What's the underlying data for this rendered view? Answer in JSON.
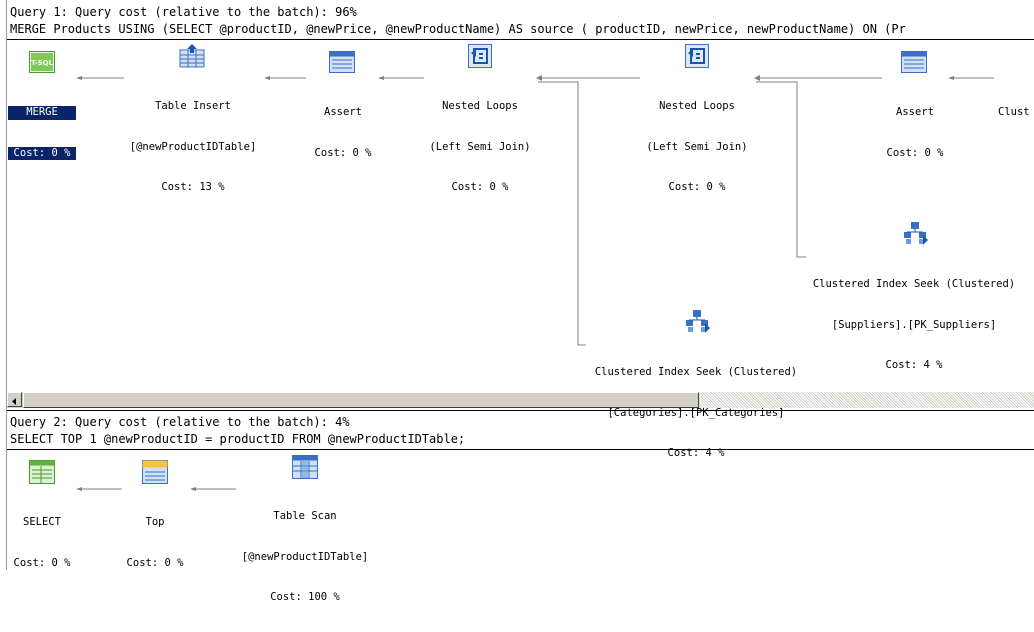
{
  "query1": {
    "header": "Query 1: Query cost (relative to the batch): 96%",
    "statement": "MERGE Products USING (SELECT @productID, @newPrice, @newProductName) AS source ( productID, newPrice, newProductName) ON (Pr",
    "nodes": [
      {
        "icon": "t-sql-icon",
        "lines": [
          "MERGE",
          "Cost: 0 %"
        ]
      },
      {
        "icon": "table-insert-icon",
        "lines": [
          "Table Insert",
          "[@newProductIDTable]",
          "Cost: 13 %"
        ]
      },
      {
        "icon": "assert-icon",
        "lines": [
          "Assert",
          "Cost: 0 %"
        ]
      },
      {
        "icon": "nested-loops-icon",
        "lines": [
          "Nested Loops",
          "(Left Semi Join)",
          "Cost: 0 %"
        ]
      },
      {
        "icon": "nested-loops-icon",
        "lines": [
          "Nested Loops",
          "(Left Semi Join)",
          "Cost: 0 %"
        ]
      },
      {
        "icon": "assert-icon",
        "lines": [
          "Assert",
          "Cost: 0 %"
        ]
      },
      {
        "icon": "clustered-index-icon",
        "lines": [
          "Clust"
        ]
      },
      {
        "icon": "clustered-index-seek-icon",
        "lines": [
          "Clustered Index Seek (Clustered)",
          "[Suppliers].[PK_Suppliers]",
          "Cost: 4 %"
        ]
      },
      {
        "icon": "clustered-index-seek-icon",
        "lines": [
          "Clustered Index Seek (Clustered)",
          "[Categories].[PK_Categories]",
          "Cost: 4 %"
        ]
      }
    ]
  },
  "query2": {
    "header": "Query 2: Query cost (relative to the batch): 4%",
    "statement": "SELECT TOP 1 @newProductID = productID FROM @newProductIDTable;",
    "nodes": [
      {
        "icon": "select-icon",
        "lines": [
          "SELECT",
          "Cost: 0 %"
        ]
      },
      {
        "icon": "top-icon",
        "lines": [
          "Top",
          "Cost: 0 %"
        ]
      },
      {
        "icon": "table-scan-icon",
        "lines": [
          "Table Scan",
          "[@newProductIDTable]",
          "Cost: 100 %"
        ]
      }
    ]
  },
  "colors": {
    "selection": "#0a246a",
    "arrow": "#808080",
    "scrollbar": "#d4d0c8",
    "icon_blue": "#3a6fc4",
    "icon_green": "#6cc24a"
  }
}
